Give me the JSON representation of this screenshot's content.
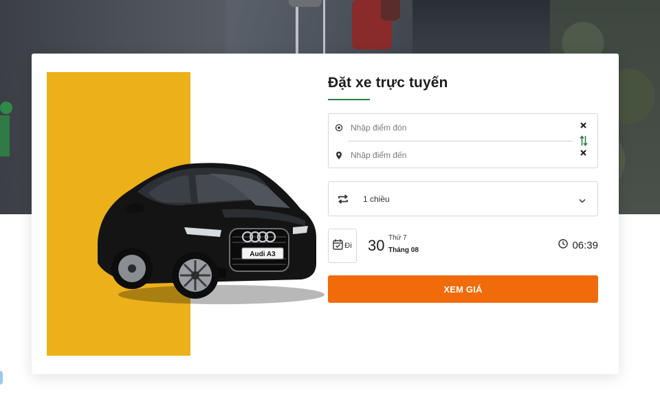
{
  "booking": {
    "title": "Đặt xe trực tuyến",
    "pickup_placeholder": "Nhập điểm đón",
    "dropoff_placeholder": "Nhập điểm đến",
    "trip_type": "1 chiều",
    "date_button_label": "Đi",
    "date_day": "30",
    "date_weekday": "Thứ 7",
    "date_month": "Tháng 08",
    "time": "06:39",
    "submit_label": "XEM GIÁ"
  },
  "car": {
    "badge": "Audi A3"
  },
  "icons": {
    "pickup": "target-pin-icon",
    "dropoff": "map-pin-icon",
    "clear": "close-icon",
    "swap": "swap-vertical-icon",
    "trip": "repeat-icon",
    "chevron": "chevron-down-icon",
    "calendar": "calendar-check-icon",
    "clock": "clock-icon"
  },
  "colors": {
    "accent_green": "#2a7f3e",
    "cta_orange": "#f26b0a",
    "yellow_panel": "#ecb118"
  }
}
